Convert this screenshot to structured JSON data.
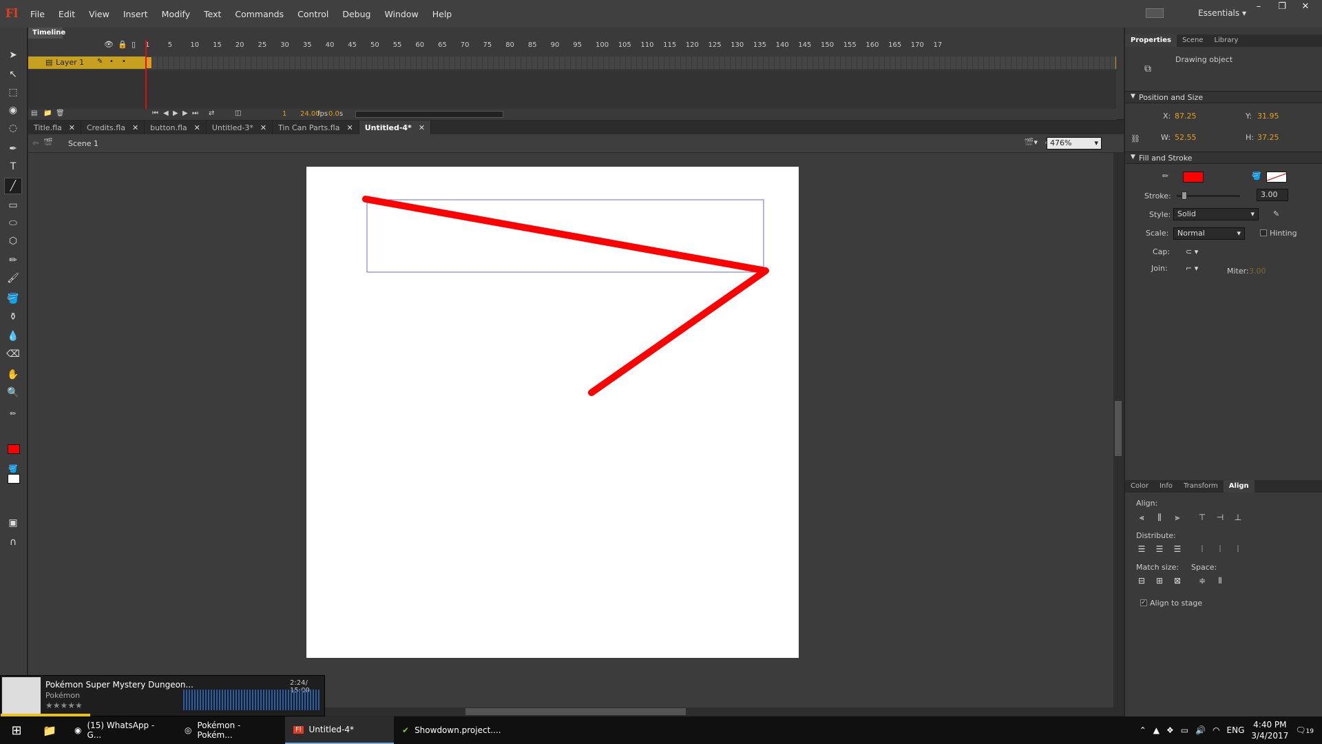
{
  "app": {
    "logo": "Fl",
    "workspace": "Essentials"
  },
  "menu": [
    "File",
    "Edit",
    "View",
    "Insert",
    "Modify",
    "Text",
    "Commands",
    "Control",
    "Debug",
    "Window",
    "Help"
  ],
  "timeline": {
    "tab": "Timeline",
    "ruler": [
      "1",
      "5",
      "10",
      "15",
      "20",
      "25",
      "30",
      "35",
      "40",
      "45",
      "50",
      "55",
      "60",
      "65",
      "70",
      "75",
      "80",
      "85",
      "90",
      "95",
      "100",
      "105",
      "110",
      "115",
      "120",
      "125",
      "130",
      "135",
      "140",
      "145",
      "150",
      "155",
      "160",
      "165",
      "170",
      "17"
    ],
    "layer": "Layer 1",
    "frame": "1",
    "fps": "24.00",
    "fps_unit": "fps",
    "time": "0.0",
    "time_unit": "s"
  },
  "doc_tabs": [
    {
      "label": "Title.fla",
      "active": false
    },
    {
      "label": "Credits.fla",
      "active": false
    },
    {
      "label": "button.fla",
      "active": false
    },
    {
      "label": "Untitled-3*",
      "active": false
    },
    {
      "label": "Tin Can Parts.fla",
      "active": false
    },
    {
      "label": "Untitled-4*",
      "active": true
    }
  ],
  "scene": "Scene 1",
  "zoom": "476%",
  "properties": {
    "tabs": [
      "Properties",
      "Scene",
      "Library"
    ],
    "object_type": "Drawing object",
    "pos_section": "Position and Size",
    "x_label": "X:",
    "x": "87.25",
    "y_label": "Y:",
    "y": "31.95",
    "w_label": "W:",
    "w": "52.55",
    "h_label": "H:",
    "h": "37.25",
    "fill_section": "Fill and Stroke",
    "stroke_label": "Stroke:",
    "stroke": "3.00",
    "style_label": "Style:",
    "style": "Solid",
    "scale_label": "Scale:",
    "scale": "Normal",
    "hinting": "Hinting",
    "cap_label": "Cap:",
    "join_label": "Join:",
    "miter_label": "Miter:",
    "miter": "3.00",
    "stroke_color": "#ff0000"
  },
  "align_panel": {
    "tabs": [
      "Color",
      "Info",
      "Transform",
      "Align"
    ],
    "align": "Align:",
    "distribute": "Distribute:",
    "match": "Match size:",
    "space": "Space:",
    "to_stage": "Align to stage"
  },
  "media": {
    "title": "Pokémon Super Mystery Dungeon...",
    "artist": "Pokémon",
    "time": "2:24/ 15:00"
  },
  "taskbar": {
    "items": [
      "(15) WhatsApp - G...",
      "Pokémon - Pokém...",
      "Untitled-4*",
      "Showdown.project...."
    ],
    "lang": "ENG",
    "time": "4:40 PM",
    "date": "3/4/2017",
    "notifications": "19"
  }
}
